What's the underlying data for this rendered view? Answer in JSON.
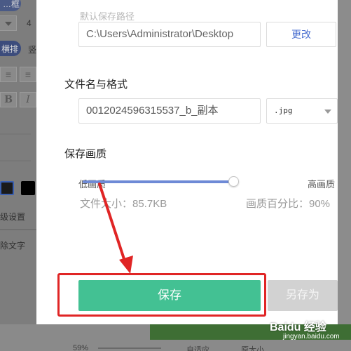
{
  "background": {
    "left_pill_1": "…框",
    "left_pill_2": "横排",
    "left_pill_3": "竖",
    "left_field_value": "4",
    "bold_tool": "B",
    "italic_tool": "I",
    "advanced_settings": "级设置",
    "text_layer": "除文字",
    "zoom_value": "59%",
    "fit_label": "自适应",
    "actual_size_label": "原大小"
  },
  "dialog": {
    "default_path_label": "默认保存路径",
    "path_value": "C:\\Users\\Administrator\\Desktop",
    "change_button": "更改",
    "filename_section": "文件名与格式",
    "filename_value": "0012024596315537_b_副本",
    "format_value": ".jpg",
    "quality_section": "保存画质",
    "quality_low": "低画质",
    "quality_high": "高画质",
    "quality_percent": 90,
    "file_size": "文件大小：85.7KB",
    "quality_text": "画质百分比：90%",
    "save_button": "保存",
    "save_as_button": "另存为"
  },
  "colors": {
    "accent_green": "#43c193",
    "slider_blue": "#6e8ad6",
    "annotation_red": "#e02525"
  },
  "watermark": {
    "brand": "Baidu 经验",
    "url": "jingyan.baidu.com"
  }
}
